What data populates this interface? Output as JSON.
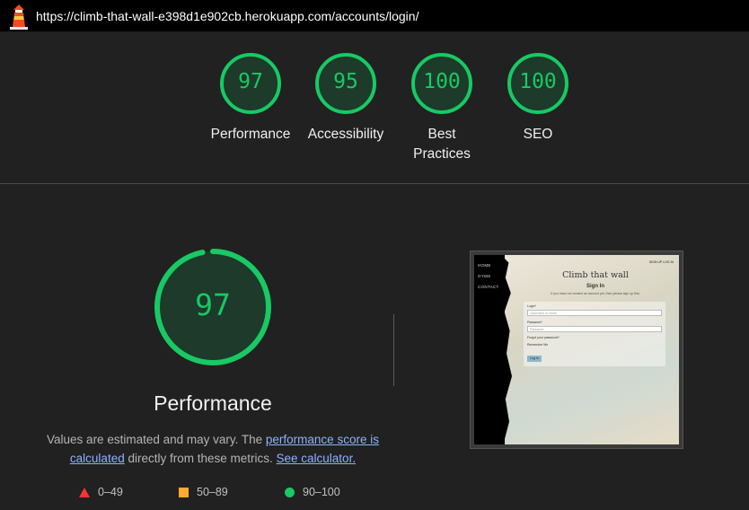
{
  "browser": {
    "url": "https://climb-that-wall-e398d1e902cb.herokuapp.com/accounts/login/",
    "icon": "lighthouse-icon"
  },
  "summary_scores": [
    {
      "label": "Performance",
      "score": "97"
    },
    {
      "label": "Accessibility",
      "score": "95"
    },
    {
      "label": "Best Practices",
      "score": "100"
    },
    {
      "label": "SEO",
      "score": "100"
    }
  ],
  "performance": {
    "score": "97",
    "title": "Performance",
    "desc_prefix": "Values are estimated and may vary. The ",
    "desc_link1": "performance score is calculated",
    "desc_middle": " directly from these metrics. ",
    "desc_link2": "See calculator."
  },
  "legend": {
    "fail": "0–49",
    "average": "50–89",
    "pass": "90–100"
  },
  "screenshot": {
    "nav_home": "HOME",
    "nav_gyms": "GYMS",
    "nav_contact": "CONTACT",
    "top_links": "SIGN UP    LOG IN",
    "brand": "Climb that wall",
    "heading": "Sign In",
    "subtext": "If you have not created an account yet, then please sign up first.",
    "login_label": "Login*",
    "login_placeholder": "Username or email",
    "password_label": "Password*",
    "password_placeholder": "Password",
    "forgot": "Forgot your password?",
    "remember": "Remember Me",
    "button": "Log In"
  },
  "colors": {
    "pass": "#18c964",
    "average": "#ffaa33",
    "fail": "#ff3333",
    "link": "#8ab4f8",
    "background": "#212121"
  }
}
